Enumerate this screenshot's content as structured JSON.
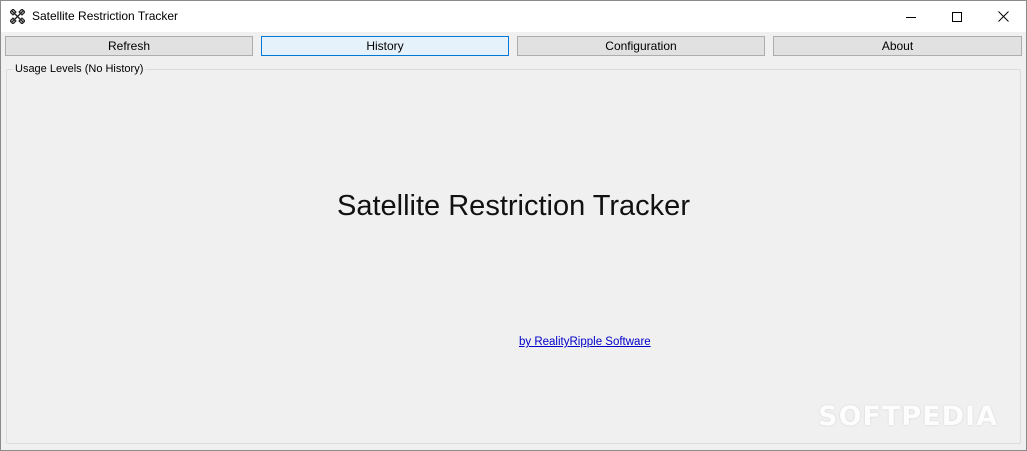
{
  "window": {
    "title": "Satellite Restriction Tracker",
    "icon": "satellite-icon",
    "controls": {
      "minimize": "minimize-icon",
      "maximize": "maximize-icon",
      "close": "close-icon"
    }
  },
  "toolbar": {
    "buttons": [
      {
        "label": "Refresh"
      },
      {
        "label": "History",
        "active": true
      },
      {
        "label": "Configuration"
      },
      {
        "label": "About"
      }
    ]
  },
  "group": {
    "label": "Usage Levels (No History)"
  },
  "main": {
    "title": "Satellite Restriction Tracker",
    "credit_link": "by RealityRipple Software"
  },
  "watermark": "SOFTPEDIA",
  "colors": {
    "client_bg": "#f0f0f0",
    "button_bg": "#e1e1e1",
    "active_button_border": "#0078d7",
    "active_button_bg": "#e5f1fb",
    "link": "#0000c8"
  }
}
